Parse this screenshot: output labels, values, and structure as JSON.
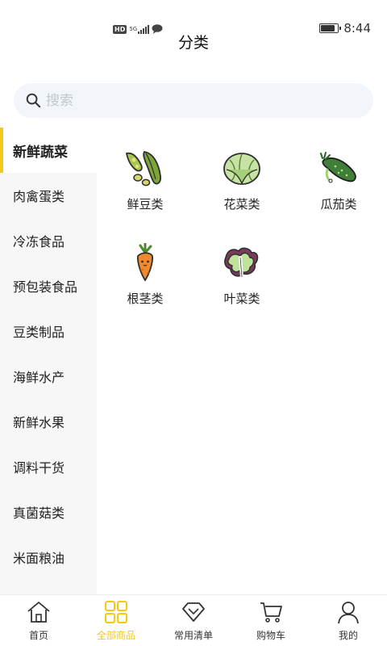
{
  "status_bar": {
    "hd": "HD",
    "network": "5G",
    "time": "8:44",
    "battery_level": 0.85
  },
  "header": {
    "title": "分类"
  },
  "search": {
    "placeholder": "搜索"
  },
  "sidebar": {
    "items": [
      {
        "label": "新鲜蔬菜",
        "active": true
      },
      {
        "label": "肉禽蛋类"
      },
      {
        "label": "冷冻食品"
      },
      {
        "label": "预包装食品"
      },
      {
        "label": "豆类制品"
      },
      {
        "label": "海鲜水产"
      },
      {
        "label": "新鲜水果"
      },
      {
        "label": "调料干货"
      },
      {
        "label": "真菌菇类"
      },
      {
        "label": "米面粮油"
      }
    ]
  },
  "categories": [
    {
      "label": "鲜豆类",
      "icon": "edamame-icon"
    },
    {
      "label": "花菜类",
      "icon": "cabbage-icon"
    },
    {
      "label": "瓜茄类",
      "icon": "cucumber-icon"
    },
    {
      "label": "根茎类",
      "icon": "carrot-icon"
    },
    {
      "label": "叶菜类",
      "icon": "lettuce-icon"
    }
  ],
  "bottom_nav": {
    "items": [
      {
        "label": "首页",
        "icon": "home-icon"
      },
      {
        "label": "全部商品",
        "icon": "grid-icon",
        "active": true
      },
      {
        "label": "常用清单",
        "icon": "diamond-icon"
      },
      {
        "label": "购物车",
        "icon": "cart-icon"
      },
      {
        "label": "我的",
        "icon": "user-icon"
      }
    ]
  },
  "colors": {
    "accent": "#f4c817",
    "sidebar_bg": "#f7f7f7",
    "search_bg": "#f2f5fa"
  }
}
